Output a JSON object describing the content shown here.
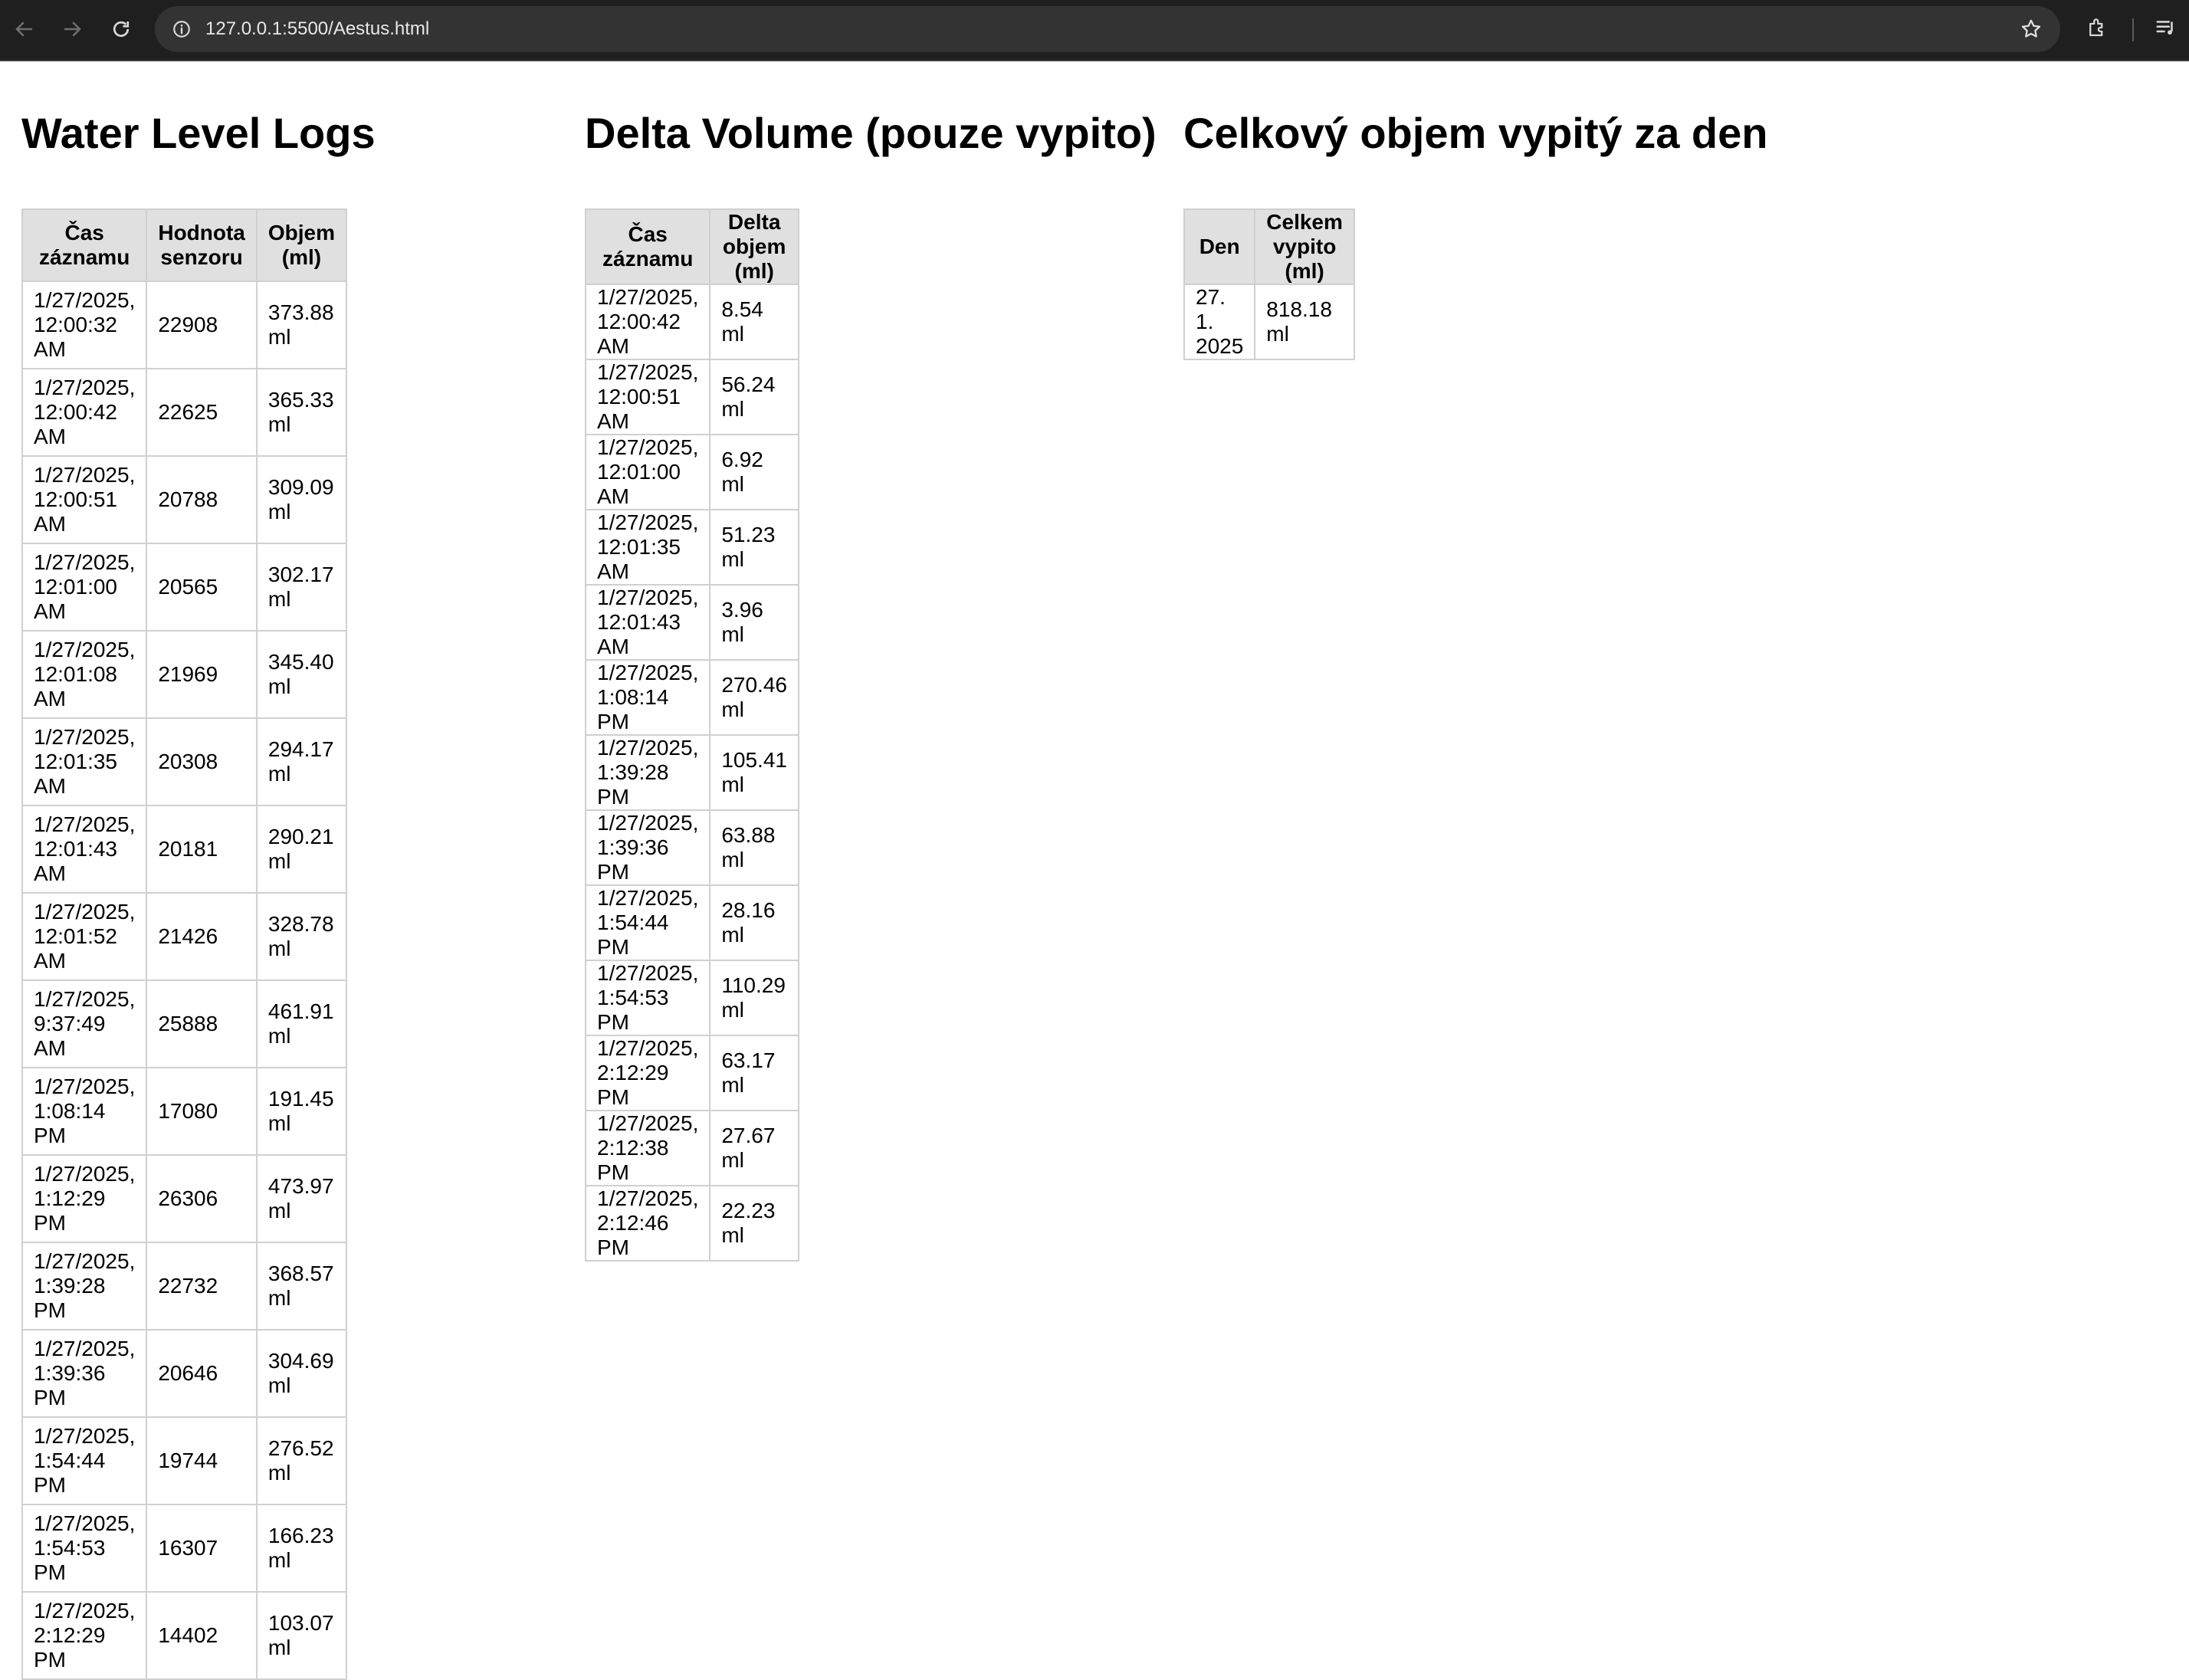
{
  "browser": {
    "url": "127.0.0.1:5500/Aestus.html"
  },
  "logs": {
    "title": "Water Level Logs",
    "headers": [
      "Čas záznamu",
      "Hodnota senzoru",
      "Objem (ml)"
    ],
    "rows": [
      [
        "1/27/2025, 12:00:32 AM",
        "22908",
        "373.88 ml"
      ],
      [
        "1/27/2025, 12:00:42 AM",
        "22625",
        "365.33 ml"
      ],
      [
        "1/27/2025, 12:00:51 AM",
        "20788",
        "309.09 ml"
      ],
      [
        "1/27/2025, 12:01:00 AM",
        "20565",
        "302.17 ml"
      ],
      [
        "1/27/2025, 12:01:08 AM",
        "21969",
        "345.40 ml"
      ],
      [
        "1/27/2025, 12:01:35 AM",
        "20308",
        "294.17 ml"
      ],
      [
        "1/27/2025, 12:01:43 AM",
        "20181",
        "290.21 ml"
      ],
      [
        "1/27/2025, 12:01:52 AM",
        "21426",
        "328.78 ml"
      ],
      [
        "1/27/2025, 9:37:49 AM",
        "25888",
        "461.91 ml"
      ],
      [
        "1/27/2025, 1:08:14 PM",
        "17080",
        "191.45 ml"
      ],
      [
        "1/27/2025, 1:12:29 PM",
        "26306",
        "473.97 ml"
      ],
      [
        "1/27/2025, 1:39:28 PM",
        "22732",
        "368.57 ml"
      ],
      [
        "1/27/2025, 1:39:36 PM",
        "20646",
        "304.69 ml"
      ],
      [
        "1/27/2025, 1:54:44 PM",
        "19744",
        "276.52 ml"
      ],
      [
        "1/27/2025, 1:54:53 PM",
        "16307",
        "166.23 ml"
      ],
      [
        "1/27/2025, 2:12:29 PM",
        "14402",
        "103.07 ml"
      ]
    ]
  },
  "delta": {
    "title": "Delta Volume (pouze vypito)",
    "headers": [
      "Čas záznamu",
      "Delta objem (ml)"
    ],
    "rows": [
      [
        "1/27/2025, 12:00:42 AM",
        "8.54 ml"
      ],
      [
        "1/27/2025, 12:00:51 AM",
        "56.24 ml"
      ],
      [
        "1/27/2025, 12:01:00 AM",
        "6.92 ml"
      ],
      [
        "1/27/2025, 12:01:35 AM",
        "51.23 ml"
      ],
      [
        "1/27/2025, 12:01:43 AM",
        "3.96 ml"
      ],
      [
        "1/27/2025, 1:08:14 PM",
        "270.46 ml"
      ],
      [
        "1/27/2025, 1:39:28 PM",
        "105.41 ml"
      ],
      [
        "1/27/2025, 1:39:36 PM",
        "63.88 ml"
      ],
      [
        "1/27/2025, 1:54:44 PM",
        "28.16 ml"
      ],
      [
        "1/27/2025, 1:54:53 PM",
        "110.29 ml"
      ],
      [
        "1/27/2025, 2:12:29 PM",
        "63.17 ml"
      ],
      [
        "1/27/2025, 2:12:38 PM",
        "27.67 ml"
      ],
      [
        "1/27/2025, 2:12:46 PM",
        "22.23 ml"
      ]
    ]
  },
  "total": {
    "title": "Celkový objem vypitý za den",
    "headers": [
      "Den",
      "Celkem vypito (ml)"
    ],
    "rows": [
      [
        "27. 1. 2025",
        "818.18 ml"
      ]
    ]
  }
}
